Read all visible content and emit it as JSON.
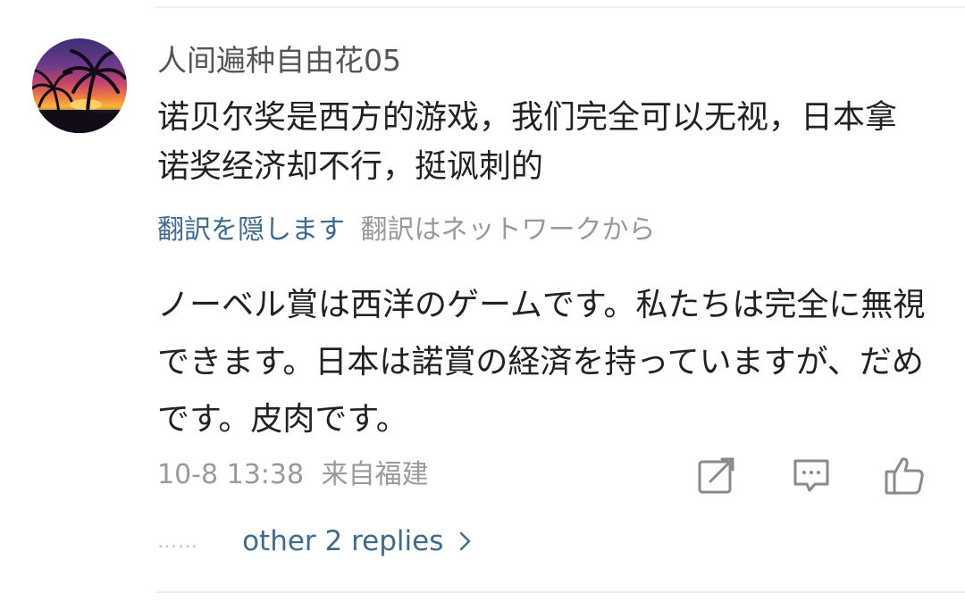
{
  "comment": {
    "username": "人间遍种自由花05",
    "text": "诺贝尔奖是西方的游戏，我们完全可以无视，日本拿诺奖经济却不行，挺讽刺的",
    "translation_toggle": "翻訳を隠します",
    "translation_source": "翻訳はネットワークから",
    "translation": "ノーベル賞は西洋のゲームです。私たちは完全に無視できます。日本は諾賞の経済を持っていますが、だめです。皮肉です。",
    "timestamp": "10-8 13:38",
    "location": "来自福建",
    "replies_dots": "……",
    "replies_label": "other 2 replies",
    "avatar_icon": "sunset-palm-trees-avatar"
  },
  "actions": {
    "share_icon": "share-icon",
    "comment_icon": "comment-icon",
    "like_icon": "thumbs-up-icon"
  },
  "colors": {
    "link": "#3f6b8f",
    "text": "#222222",
    "meta": "#9a9a9a",
    "icon": "#8a8a8a"
  }
}
